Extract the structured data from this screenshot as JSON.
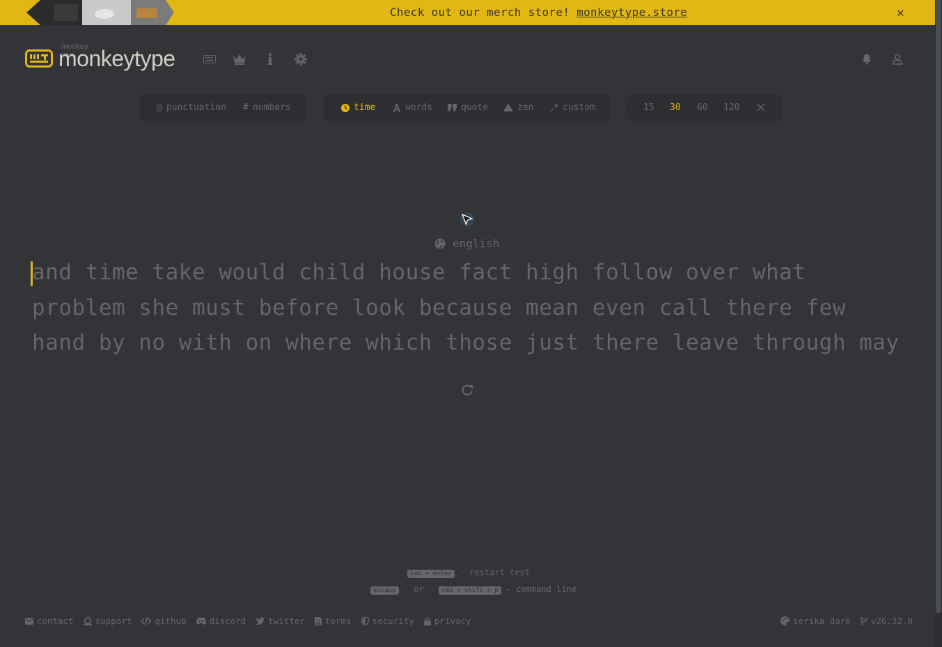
{
  "banner": {
    "text": "Check out our merch store! ",
    "link": "monkeytype.store",
    "close": "✕"
  },
  "header": {
    "logo_sub": "monkey see",
    "logo_text": "monkeytype",
    "nav_icons": [
      "keyboard-icon",
      "crown-icon",
      "info-icon",
      "gear-icon"
    ],
    "right_icons": [
      "bell-icon",
      "user-icon"
    ]
  },
  "config": {
    "modifiers": [
      {
        "icon": "@",
        "label": "punctuation"
      },
      {
        "icon": "#",
        "label": "numbers"
      }
    ],
    "modes": [
      {
        "label": "time",
        "active": true
      },
      {
        "label": "words"
      },
      {
        "label": "quote"
      },
      {
        "label": "zen"
      },
      {
        "label": "custom"
      }
    ],
    "durations": [
      "15",
      "30",
      "60",
      "120"
    ],
    "active_duration": "30"
  },
  "test": {
    "language": "english",
    "lines": [
      "and time take would child house fact high follow over what",
      "problem she must before look because mean even call there few",
      "hand by no with on where which those just there leave through may"
    ]
  },
  "hints": {
    "restart_key": "tab + enter",
    "restart_text": "- restart test",
    "escape_key": "escape",
    "or": "or",
    "command_key": "cmd + shift + p",
    "command_text": "- command line"
  },
  "footer": {
    "links": [
      "contact",
      "support",
      "github",
      "discord",
      "twitter",
      "terms",
      "security",
      "privacy"
    ],
    "theme": "serika dark",
    "version": "v26.32.0"
  },
  "colors": {
    "background": "#323437",
    "accent": "#e2b714",
    "text_dim": "#646669",
    "text_main": "#d1d0c5"
  }
}
